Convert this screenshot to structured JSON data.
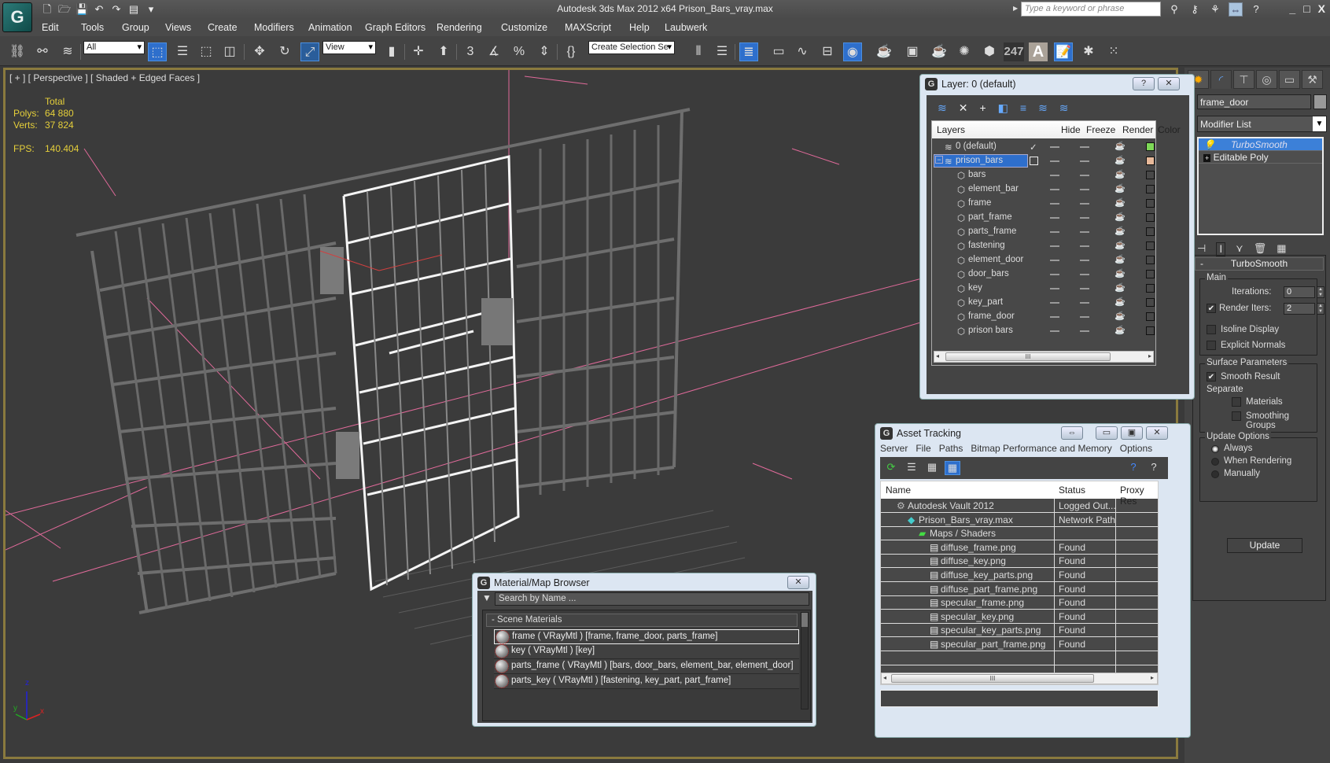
{
  "app": {
    "title": "Autodesk 3ds Max  2012 x64     Prison_Bars_vray.max",
    "logo": "3ds-max-logo",
    "search_placeholder": "Type a keyword or phrase",
    "quick_access": [
      "new-icon",
      "open-icon",
      "save-icon",
      "undo-icon",
      "redo-icon",
      "project-icon",
      "customize-icon"
    ]
  },
  "menu": [
    "Edit",
    "Tools",
    "Group",
    "Views",
    "Create",
    "Modifiers",
    "Animation",
    "Graph Editors",
    "Rendering",
    "Customize",
    "MAXScript",
    "Help",
    "Laubwerk"
  ],
  "toolbar": {
    "selection_filter": "All",
    "reference_coord": "View",
    "named_selection": "Create Selection Se",
    "snap_label": "3",
    "counter": "247",
    "text_icon": "A"
  },
  "viewport": {
    "label": "[ + ] [ Perspective ] [ Shaded + Edged Faces ]",
    "stats": {
      "header": "Total",
      "polys_label": "Polys:",
      "polys": "64 880",
      "verts_label": "Verts:",
      "verts": "37 824",
      "fps_label": "FPS:",
      "fps": "140.404"
    },
    "axis": {
      "x": "x",
      "y": "y",
      "z": "z"
    }
  },
  "command_panel": {
    "object_name": "frame_door",
    "modifier_list": "Modifier List",
    "stack": [
      {
        "label": "TurboSmooth",
        "selected": true
      },
      {
        "label": "Editable Poly",
        "selected": false
      }
    ],
    "rollout_title": "TurboSmooth",
    "main_group": "Main",
    "iterations_label": "Iterations:",
    "iterations": "0",
    "render_iters_label": "Render Iters:",
    "render_iters": "2",
    "render_iters_checked": true,
    "isoline_label": "Isoline Display",
    "isoline_checked": false,
    "explicit_normals_label": "Explicit Normals",
    "explicit_normals_checked": false,
    "surface_group": "Surface Parameters",
    "smooth_result_label": "Smooth Result",
    "smooth_result_checked": true,
    "separate_label": "Separate",
    "materials_label": "Materials",
    "smoothing_groups_label": "Smoothing Groups",
    "update_group": "Update Options",
    "update_options": [
      "Always",
      "When Rendering",
      "Manually"
    ],
    "update_selected": "Always",
    "update_button": "Update"
  },
  "layer_dialog": {
    "title": "Layer: 0 (default)",
    "columns": [
      "Layers",
      "Hide",
      "Freeze",
      "Render",
      "Color"
    ],
    "rows": [
      {
        "name": "0 (default)",
        "level": 0,
        "type": "layer",
        "current": true,
        "color": "#7ed957"
      },
      {
        "name": "prison_bars",
        "level": 0,
        "type": "layer",
        "selected": true,
        "color": "#e8b99a"
      },
      {
        "name": "bars",
        "level": 1,
        "type": "object",
        "color": ""
      },
      {
        "name": "element_bar",
        "level": 1,
        "type": "object",
        "color": ""
      },
      {
        "name": "frame",
        "level": 1,
        "type": "object",
        "color": ""
      },
      {
        "name": "part_frame",
        "level": 1,
        "type": "object",
        "color": ""
      },
      {
        "name": "parts_frame",
        "level": 1,
        "type": "object",
        "color": ""
      },
      {
        "name": "fastening",
        "level": 1,
        "type": "object",
        "color": ""
      },
      {
        "name": "element_door",
        "level": 1,
        "type": "object",
        "color": ""
      },
      {
        "name": "door_bars",
        "level": 1,
        "type": "object",
        "color": ""
      },
      {
        "name": "key",
        "level": 1,
        "type": "object",
        "color": ""
      },
      {
        "name": "key_part",
        "level": 1,
        "type": "object",
        "color": ""
      },
      {
        "name": "frame_door",
        "level": 1,
        "type": "object",
        "color": ""
      },
      {
        "name": "prison bars",
        "level": 1,
        "type": "object",
        "color": ""
      }
    ]
  },
  "asset_tracking": {
    "title": "Asset Tracking",
    "menu": [
      "Server",
      "File",
      "Paths",
      "Bitmap Performance and Memory",
      "Options"
    ],
    "columns": [
      "Name",
      "Status",
      "Proxy Res"
    ],
    "rows": [
      {
        "name": "Autodesk Vault 2012",
        "status": "Logged Out...",
        "level": 1,
        "icon": "vault-icon"
      },
      {
        "name": "Prison_Bars_vray.max",
        "status": "Network Path",
        "level": 2,
        "icon": "max-file-icon"
      },
      {
        "name": "Maps / Shaders",
        "status": "",
        "level": 3,
        "icon": "maps-icon"
      },
      {
        "name": "diffuse_frame.png",
        "status": "Found",
        "level": 4,
        "icon": "bitmap-icon"
      },
      {
        "name": "diffuse_key.png",
        "status": "Found",
        "level": 4,
        "icon": "bitmap-icon"
      },
      {
        "name": "diffuse_key_parts.png",
        "status": "Found",
        "level": 4,
        "icon": "bitmap-icon"
      },
      {
        "name": "diffuse_part_frame.png",
        "status": "Found",
        "level": 4,
        "icon": "bitmap-icon"
      },
      {
        "name": "specular_frame.png",
        "status": "Found",
        "level": 4,
        "icon": "bitmap-icon"
      },
      {
        "name": "specular_key.png",
        "status": "Found",
        "level": 4,
        "icon": "bitmap-icon"
      },
      {
        "name": "specular_key_parts.png",
        "status": "Found",
        "level": 4,
        "icon": "bitmap-icon"
      },
      {
        "name": "specular_part_frame.png",
        "status": "Found",
        "level": 4,
        "icon": "bitmap-icon"
      }
    ]
  },
  "material_browser": {
    "title": "Material/Map Browser",
    "search_placeholder": "Search by Name ...",
    "category": "- Scene Materials",
    "items": [
      "frame  ( VRayMtl )  [frame, frame_door, parts_frame]",
      "key  ( VRayMtl )  [key]",
      "parts_frame  ( VRayMtl )  [bars, door_bars, element_bar, element_door]",
      "parts_key  ( VRayMtl )  [fastening, key_part, part_frame]"
    ]
  },
  "colors": {
    "accent": "#2e6fcc",
    "viewport_border": "#8a7a3e",
    "stats_text": "#e5cf3a",
    "grid_line": "#e06a9a"
  }
}
